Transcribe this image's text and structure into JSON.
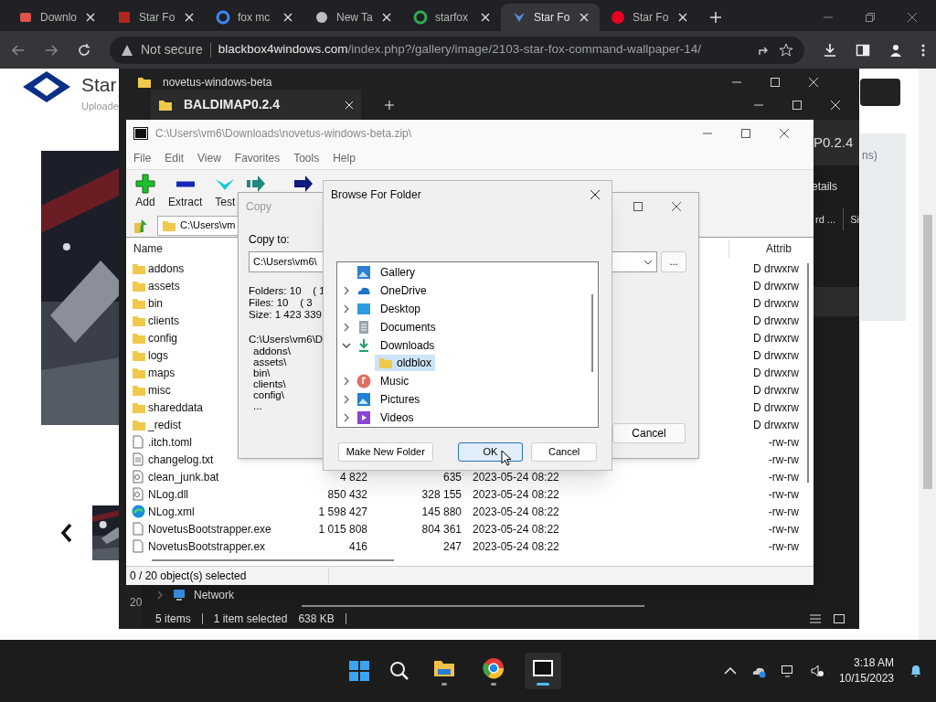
{
  "browser": {
    "tabs": [
      {
        "title": "Downlo",
        "selected": false
      },
      {
        "title": "Star Fo",
        "selected": false
      },
      {
        "title": "fox mc",
        "selected": false
      },
      {
        "title": "New Ta",
        "selected": false
      },
      {
        "title": "starfox",
        "selected": false
      },
      {
        "title": "Star Fo",
        "selected": true
      },
      {
        "title": "Star Fo",
        "selected": false
      }
    ],
    "address": {
      "security": "Not secure",
      "domain": "blackbox4windows.com",
      "path": "/index.php?/gallery/image/2103-star-fox-command-wallpaper-14/"
    },
    "page": {
      "title": "Star",
      "subtitle": "Uploade",
      "side_text": "ns)"
    }
  },
  "explorer_back": {
    "tab_title": "novetus-windows-beta",
    "status_text": "20"
  },
  "explorer_front": {
    "tab_title": "BALDIMAP0.2.4",
    "location": "P0.2.4",
    "toolbar_text": "etails",
    "columns": [
      "rd ...",
      "Si"
    ],
    "nav_item": "Network",
    "status": [
      "5 items",
      "1 item selected",
      "638 KB"
    ]
  },
  "sevenzip": {
    "title": "C:\\Users\\vm6\\Downloads\\novetus-windows-beta.zip\\",
    "menu": [
      "File",
      "Edit",
      "View",
      "Favorites",
      "Tools",
      "Help"
    ],
    "toolbar": [
      "Add",
      "Extract",
      "Test"
    ],
    "path": "C:\\Users\\vm",
    "columns": [
      "Name",
      "Attrib"
    ],
    "rows": [
      {
        "name": "addons",
        "kind": "folder",
        "attrib": "D drwxrw"
      },
      {
        "name": "assets",
        "kind": "folder",
        "attrib": "D drwxrw"
      },
      {
        "name": "bin",
        "kind": "folder",
        "attrib": "D drwxrw"
      },
      {
        "name": "clients",
        "kind": "folder",
        "attrib": "D drwxrw"
      },
      {
        "name": "config",
        "kind": "folder",
        "attrib": "D drwxrw"
      },
      {
        "name": "logs",
        "kind": "folder",
        "attrib": "D drwxrw"
      },
      {
        "name": "maps",
        "kind": "folder",
        "attrib": "D drwxrw"
      },
      {
        "name": "misc",
        "kind": "folder",
        "attrib": "D drwxrw"
      },
      {
        "name": "shareddata",
        "kind": "folder",
        "attrib": "D drwxrw"
      },
      {
        "name": "_redist",
        "kind": "folder",
        "attrib": "D drwxrw"
      },
      {
        "name": ".itch.toml",
        "kind": "file",
        "attrib": "-rw-rw"
      },
      {
        "name": "changelog.txt",
        "kind": "text",
        "attrib": "-rw-rw"
      },
      {
        "name": "clean_junk.bat",
        "kind": "script",
        "size": "4 822",
        "packed": "635",
        "modified": "2023-05-24 08:22",
        "attrib": "-rw-rw"
      },
      {
        "name": "NLog.dll",
        "kind": "script",
        "size": "850 432",
        "packed": "328 155",
        "modified": "2023-05-24 08:22",
        "attrib": "-rw-rw"
      },
      {
        "name": "NLog.xml",
        "kind": "web",
        "size": "1 598 427",
        "packed": "145 880",
        "modified": "2023-05-24 08:22",
        "attrib": "-rw-rw"
      },
      {
        "name": "NovetusBootstrapper.exe",
        "kind": "file",
        "size": "1 015 808",
        "packed": "804 361",
        "modified": "2023-05-24 08:22",
        "attrib": "-rw-rw"
      },
      {
        "name": "NovetusBootstrapper.ex",
        "kind": "file",
        "size": "416",
        "packed": "247",
        "modified": "2023-05-24 08:22",
        "attrib": "-rw-rw"
      }
    ],
    "status": "0 / 20 object(s) selected"
  },
  "copy_dialog": {
    "title": "Copy",
    "copy_to_label": "Copy to:",
    "path_value": "C:\\Users\\vm6\\",
    "summary": [
      "Folders: 10    ( 1",
      "Files: 10    ( 3",
      "Size: 1 423 339"
    ],
    "source": "C:\\Users\\vm6\\D",
    "items": [
      "addons\\",
      "assets\\",
      "bin\\",
      "clients\\",
      "config\\",
      "..."
    ],
    "browse_button": "...",
    "cancel_button": "Cancel"
  },
  "browse_dialog": {
    "title": "Browse For Folder",
    "tree": [
      {
        "label": "Gallery",
        "expandable": false,
        "expanded": false,
        "selected": false
      },
      {
        "label": "OneDrive",
        "expandable": true,
        "expanded": false,
        "selected": false
      },
      {
        "label": "Desktop",
        "expandable": true,
        "expanded": false,
        "selected": false
      },
      {
        "label": "Documents",
        "expandable": true,
        "expanded": false,
        "selected": false
      },
      {
        "label": "Downloads",
        "expandable": true,
        "expanded": true,
        "selected": false,
        "children": [
          {
            "label": "oldblox",
            "selected": true
          }
        ]
      },
      {
        "label": "Music",
        "expandable": true,
        "expanded": false,
        "selected": false
      },
      {
        "label": "Pictures",
        "expandable": true,
        "expanded": false,
        "selected": false
      },
      {
        "label": "Videos",
        "expandable": true,
        "expanded": false,
        "selected": false
      }
    ],
    "buttons": [
      {
        "label": "Make New Folder",
        "focused": false
      },
      {
        "label": "OK",
        "focused": true
      },
      {
        "label": "Cancel",
        "focused": false
      }
    ]
  },
  "taskbar": {
    "apps": [
      {
        "active": false
      },
      {
        "active": false
      },
      {
        "active": true
      }
    ],
    "time": "3:18 AM",
    "date": "10/15/2023"
  }
}
